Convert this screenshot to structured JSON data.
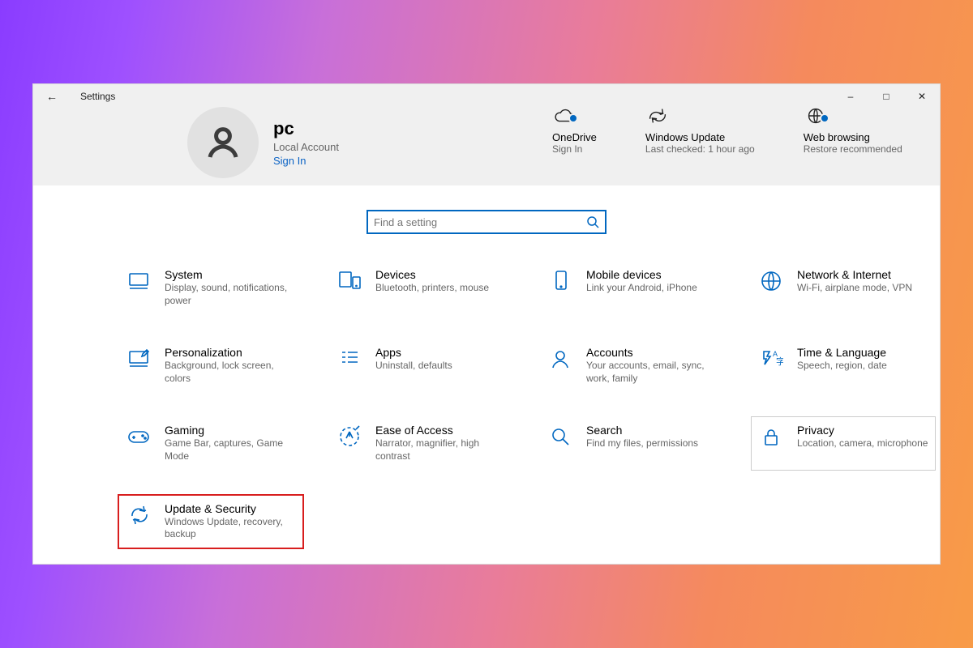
{
  "window": {
    "title": "Settings"
  },
  "account": {
    "name": "pc",
    "type": "Local Account",
    "signin": "Sign In"
  },
  "status": [
    {
      "id": "onedrive",
      "title": "OneDrive",
      "sub": "Sign In",
      "dot": true
    },
    {
      "id": "winupdate",
      "title": "Windows Update",
      "sub": "Last checked: 1 hour ago",
      "dot": false
    },
    {
      "id": "webbrowsing",
      "title": "Web browsing",
      "sub": "Restore recommended",
      "dot": true
    }
  ],
  "search": {
    "placeholder": "Find a setting"
  },
  "categories": [
    {
      "id": "system",
      "title": "System",
      "desc": "Display, sound, notifications, power"
    },
    {
      "id": "devices",
      "title": "Devices",
      "desc": "Bluetooth, printers, mouse"
    },
    {
      "id": "mobile",
      "title": "Mobile devices",
      "desc": "Link your Android, iPhone"
    },
    {
      "id": "network",
      "title": "Network & Internet",
      "desc": "Wi-Fi, airplane mode, VPN"
    },
    {
      "id": "personalization",
      "title": "Personalization",
      "desc": "Background, lock screen, colors"
    },
    {
      "id": "apps",
      "title": "Apps",
      "desc": "Uninstall, defaults"
    },
    {
      "id": "accounts",
      "title": "Accounts",
      "desc": "Your accounts, email, sync, work, family"
    },
    {
      "id": "time",
      "title": "Time & Language",
      "desc": "Speech, region, date"
    },
    {
      "id": "gaming",
      "title": "Gaming",
      "desc": "Game Bar, captures, Game Mode"
    },
    {
      "id": "ease",
      "title": "Ease of Access",
      "desc": "Narrator, magnifier, high contrast"
    },
    {
      "id": "search-cat",
      "title": "Search",
      "desc": "Find my files, permissions"
    },
    {
      "id": "privacy",
      "title": "Privacy",
      "desc": "Location, camera, microphone"
    },
    {
      "id": "update",
      "title": "Update & Security",
      "desc": "Windows Update, recovery, backup"
    }
  ],
  "highlight": "update",
  "hover": "privacy"
}
